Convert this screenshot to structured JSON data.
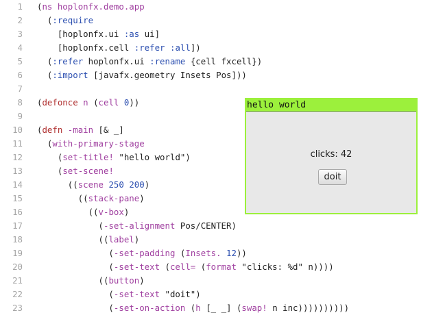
{
  "editor": {
    "lines": [
      {
        "n": "1",
        "tokens": [
          [
            "(",
            "default"
          ],
          [
            "ns",
            "keyword"
          ],
          [
            " hoplonfx.demo.app",
            "keyword"
          ]
        ]
      },
      {
        "n": "2",
        "tokens": [
          [
            "  (",
            "default"
          ],
          [
            ":require",
            "symbol"
          ]
        ]
      },
      {
        "n": "3",
        "tokens": [
          [
            "    [hoplonfx.ui ",
            "default"
          ],
          [
            ":as",
            "symbol"
          ],
          [
            " ui]",
            "default"
          ]
        ]
      },
      {
        "n": "4",
        "tokens": [
          [
            "    [hoplonfx.cell ",
            "default"
          ],
          [
            ":refer",
            "symbol"
          ],
          [
            " ",
            "default"
          ],
          [
            ":all",
            "symbol"
          ],
          [
            "])",
            "default"
          ]
        ]
      },
      {
        "n": "5",
        "tokens": [
          [
            "  (",
            "default"
          ],
          [
            ":refer",
            "symbol"
          ],
          [
            " hoplonfx.ui ",
            "default"
          ],
          [
            ":rename",
            "symbol"
          ],
          [
            " {cell fxcell})",
            "default"
          ]
        ]
      },
      {
        "n": "6",
        "tokens": [
          [
            "  (",
            "default"
          ],
          [
            ":import",
            "symbol"
          ],
          [
            " [javafx.geometry Insets Pos]))",
            "default"
          ]
        ]
      },
      {
        "n": "7",
        "tokens": []
      },
      {
        "n": "8",
        "tokens": [
          [
            "(",
            "default"
          ],
          [
            "defonce",
            "special"
          ],
          [
            " n ",
            "keyword"
          ],
          [
            "(",
            "default"
          ],
          [
            "cell",
            "keyword"
          ],
          [
            " ",
            "default"
          ],
          [
            "0",
            "number"
          ],
          [
            "))",
            "default"
          ]
        ]
      },
      {
        "n": "9",
        "tokens": []
      },
      {
        "n": "10",
        "tokens": [
          [
            "(",
            "default"
          ],
          [
            "defn",
            "special"
          ],
          [
            " -main",
            "keyword"
          ],
          [
            " [& _]",
            "default"
          ]
        ]
      },
      {
        "n": "11",
        "tokens": [
          [
            "  (",
            "default"
          ],
          [
            "with-primary-stage",
            "keyword"
          ]
        ]
      },
      {
        "n": "12",
        "tokens": [
          [
            "    (",
            "default"
          ],
          [
            "set-title!",
            "keyword"
          ],
          [
            " \"hello world\")",
            "string"
          ]
        ]
      },
      {
        "n": "13",
        "tokens": [
          [
            "    (",
            "default"
          ],
          [
            "set-scene!",
            "keyword"
          ]
        ]
      },
      {
        "n": "14",
        "tokens": [
          [
            "      ((",
            "default"
          ],
          [
            "scene",
            "keyword"
          ],
          [
            " ",
            "default"
          ],
          [
            "250",
            "number"
          ],
          [
            " ",
            "default"
          ],
          [
            "200",
            "number"
          ],
          [
            ")",
            "default"
          ]
        ]
      },
      {
        "n": "15",
        "tokens": [
          [
            "        ((",
            "default"
          ],
          [
            "stack-pane",
            "keyword"
          ],
          [
            ")",
            "default"
          ]
        ]
      },
      {
        "n": "16",
        "tokens": [
          [
            "          ((",
            "default"
          ],
          [
            "v-box",
            "keyword"
          ],
          [
            ")",
            "default"
          ]
        ]
      },
      {
        "n": "17",
        "tokens": [
          [
            "            (",
            "default"
          ],
          [
            "-set-alignment",
            "keyword"
          ],
          [
            " Pos/CENTER)",
            "default"
          ]
        ]
      },
      {
        "n": "18",
        "tokens": [
          [
            "            ((",
            "default"
          ],
          [
            "label",
            "keyword"
          ],
          [
            ")",
            "default"
          ]
        ]
      },
      {
        "n": "19",
        "tokens": [
          [
            "              (",
            "default"
          ],
          [
            "-set-padding",
            "keyword"
          ],
          [
            " (",
            "default"
          ],
          [
            "Insets.",
            "keyword"
          ],
          [
            " ",
            "default"
          ],
          [
            "12",
            "number"
          ],
          [
            "))",
            "default"
          ]
        ]
      },
      {
        "n": "20",
        "tokens": [
          [
            "              (",
            "default"
          ],
          [
            "-set-text",
            "keyword"
          ],
          [
            " (",
            "default"
          ],
          [
            "cell=",
            "keyword"
          ],
          [
            " (",
            "default"
          ],
          [
            "format",
            "keyword"
          ],
          [
            " \"clicks: %d\" n))))",
            "string"
          ]
        ]
      },
      {
        "n": "21",
        "tokens": [
          [
            "            ((",
            "default"
          ],
          [
            "button",
            "keyword"
          ],
          [
            ")",
            "default"
          ]
        ]
      },
      {
        "n": "22",
        "tokens": [
          [
            "              (",
            "default"
          ],
          [
            "-set-text",
            "keyword"
          ],
          [
            " \"doit\")",
            "string"
          ]
        ]
      },
      {
        "n": "23",
        "tokens": [
          [
            "              (",
            "default"
          ],
          [
            "-set-on-action",
            "keyword"
          ],
          [
            " (",
            "default"
          ],
          [
            "h",
            "keyword"
          ],
          [
            " [_ _] (",
            "default"
          ],
          [
            "swap!",
            "keyword"
          ],
          [
            " n inc))))))))))",
            "default"
          ]
        ]
      }
    ]
  },
  "app_window": {
    "title": "hello world",
    "clicks_label": "clicks: 42",
    "button_label": "doit",
    "titlebar_color": "#9cf03c"
  }
}
